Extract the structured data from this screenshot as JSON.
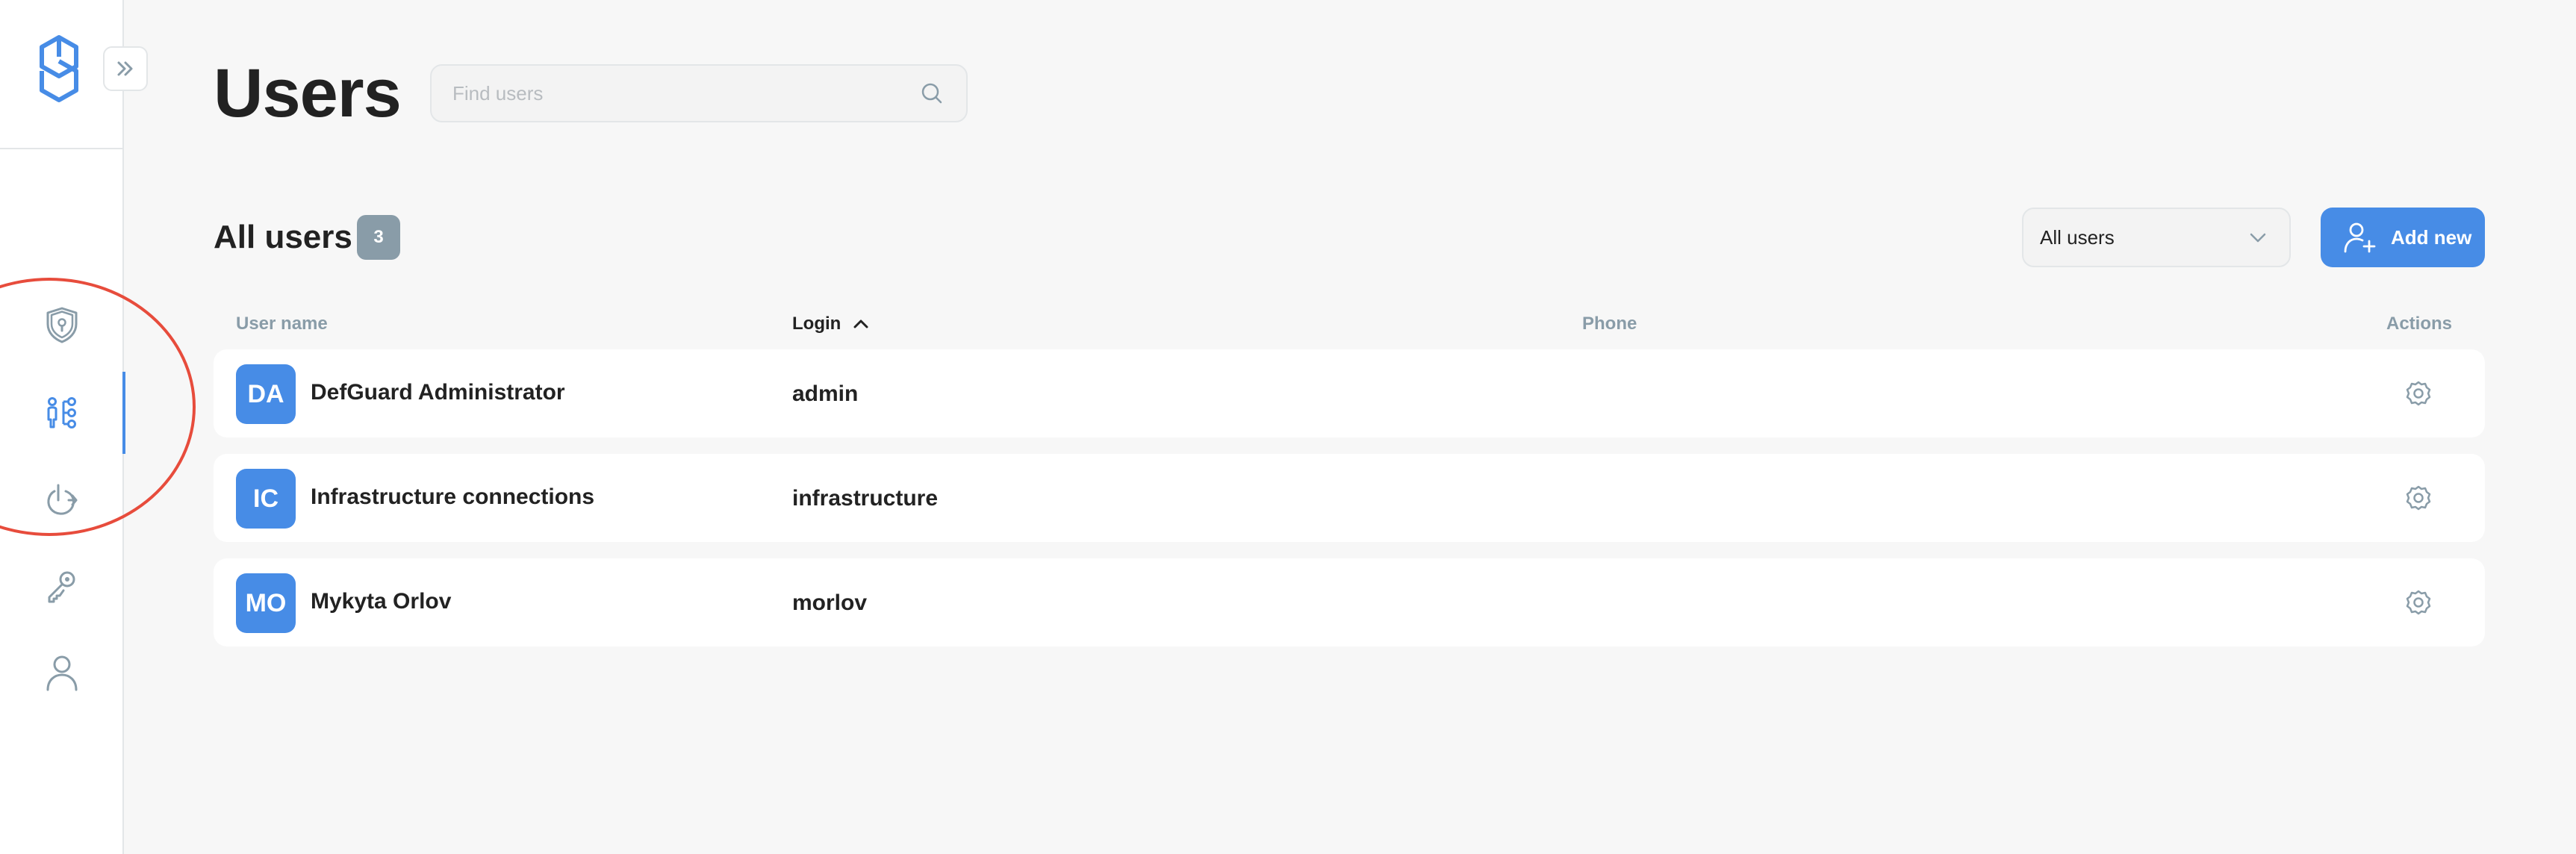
{
  "page": {
    "title": "Users"
  },
  "search": {
    "placeholder": "Find users",
    "value": ""
  },
  "section": {
    "title": "All users",
    "count": "3"
  },
  "filter": {
    "selected": "All users"
  },
  "add_button": {
    "label": "Add new"
  },
  "columns": {
    "user_name": "User name",
    "login": "Login",
    "phone": "Phone",
    "actions": "Actions"
  },
  "sort": {
    "column": "login",
    "direction": "ascending"
  },
  "users": [
    {
      "initials": "DA",
      "name": "DefGuard Administrator",
      "login": "admin",
      "phone": ""
    },
    {
      "initials": "IC",
      "name": "Infrastructure connections",
      "login": "infrastructure",
      "phone": ""
    },
    {
      "initials": "MO",
      "name": "Mykyta Orlov",
      "login": "morlov",
      "phone": ""
    }
  ],
  "sidebar": {
    "active": "users",
    "items": [
      {
        "id": "security",
        "icon": "shield-lock-icon"
      },
      {
        "id": "users",
        "icon": "users-network-icon"
      },
      {
        "id": "openid",
        "icon": "power-arrow-icon"
      },
      {
        "id": "keys",
        "icon": "key-icon"
      },
      {
        "id": "profile",
        "icon": "person-icon"
      }
    ]
  },
  "colors": {
    "accent": "#478ce6",
    "icon_gray": "#899ca8",
    "text": "#222222",
    "background": "#f7f7f7",
    "annotation": "#e74c3c"
  }
}
